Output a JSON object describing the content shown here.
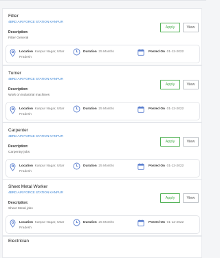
{
  "jobs": [
    {
      "title": "Fitter",
      "org": "4BRD AIR FORCE STATION KANPUR",
      "desc_label": "Description:",
      "desc": "Fitter General",
      "apply_label": "Apply",
      "view_label": "View",
      "location_label": "Location",
      "location": "Kanpur Nagar, Uttar Pradesh",
      "duration_label": "Duration",
      "duration": "25 Months",
      "posted_label": "Posted On",
      "posted": "01-12-2022"
    },
    {
      "title": "Turner",
      "org": "4BRD AIR FORCE STATION KANPUR",
      "desc_label": "Description:",
      "desc": "Work on industrial machines",
      "apply_label": "Apply",
      "view_label": "View",
      "location_label": "Location",
      "location": "Kanpur Nagar, Uttar Pradesh",
      "duration_label": "Duration",
      "duration": "25 Months",
      "posted_label": "Posted On",
      "posted": "01-12-2022"
    },
    {
      "title": "Carpenter",
      "org": "4BRD AIR FORCE STATION KANPUR",
      "desc_label": "Description:",
      "desc": "Carpentry jobs",
      "apply_label": "Apply",
      "view_label": "View",
      "location_label": "Location",
      "location": "Kanpur Nagar, Uttar Pradesh",
      "duration_label": "Duration",
      "duration": "25 Months",
      "posted_label": "Posted On",
      "posted": "01-12-2022"
    },
    {
      "title": "Sheet Metal Worker",
      "org": "4BRD AIR FORCE STATION KANPUR",
      "desc_label": "Description:",
      "desc": "Sheet Metal jobs",
      "apply_label": "Apply",
      "view_label": "View",
      "location_label": "Location",
      "location": "Kanpur Nagar, Uttar Pradesh",
      "duration_label": "Duration",
      "duration": "25 Months",
      "posted_label": "Posted On",
      "posted": "01-12-2022"
    },
    {
      "title": "Electrician"
    }
  ],
  "colors": {
    "accent_blue": "#3d86d6",
    "apply_green": "#4caf50",
    "icon_blue": "#5b7fcf"
  },
  "icons": {
    "location": "location-pin-icon",
    "duration": "clock-icon",
    "posted": "calendar-icon"
  }
}
